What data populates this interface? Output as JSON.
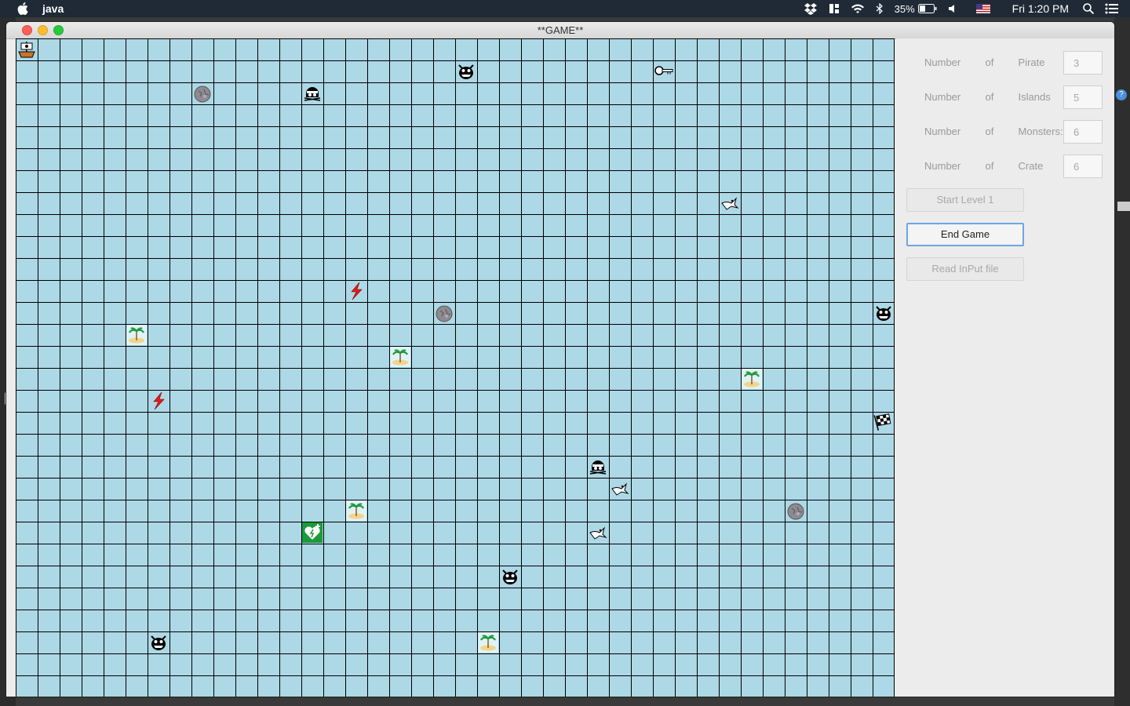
{
  "menubar": {
    "app_name": "java",
    "battery": "35%",
    "clock": "Fri 1:20 PM"
  },
  "window": {
    "title": "**GAME**"
  },
  "panel": {
    "fields": [
      {
        "label": "Number  of  Pirate   :",
        "value": "3"
      },
      {
        "label": "Number  of  Islands  :",
        "value": "5"
      },
      {
        "label": "Number  of  Monsters:",
        "value": "6"
      },
      {
        "label": "Number  of  Crate    :",
        "value": "6"
      }
    ],
    "buttons": {
      "start": "Start Level 1",
      "end": "End Game",
      "read": "Read InPut file"
    }
  },
  "board": {
    "cols": 40,
    "rows": 30,
    "pieces": [
      {
        "type": "pirate-ship",
        "col": 0,
        "row": 0
      },
      {
        "type": "rock",
        "col": 8,
        "row": 2
      },
      {
        "type": "skull",
        "col": 13,
        "row": 2
      },
      {
        "type": "monster",
        "col": 20,
        "row": 1
      },
      {
        "type": "key",
        "col": 29,
        "row": 1
      },
      {
        "type": "bird",
        "col": 32,
        "row": 7
      },
      {
        "type": "lightning",
        "col": 15,
        "row": 11
      },
      {
        "type": "rock",
        "col": 19,
        "row": 12
      },
      {
        "type": "monster",
        "col": 39,
        "row": 12
      },
      {
        "type": "island",
        "col": 5,
        "row": 13
      },
      {
        "type": "island",
        "col": 17,
        "row": 14
      },
      {
        "type": "island",
        "col": 33,
        "row": 15
      },
      {
        "type": "lightning",
        "col": 6,
        "row": 16
      },
      {
        "type": "flag",
        "col": 39,
        "row": 17
      },
      {
        "type": "skull",
        "col": 26,
        "row": 19
      },
      {
        "type": "bird",
        "col": 27,
        "row": 20
      },
      {
        "type": "island",
        "col": 15,
        "row": 21
      },
      {
        "type": "rock",
        "col": 35,
        "row": 21
      },
      {
        "type": "health",
        "col": 13,
        "row": 22
      },
      {
        "type": "bird",
        "col": 26,
        "row": 22
      },
      {
        "type": "monster",
        "col": 22,
        "row": 24
      },
      {
        "type": "monster",
        "col": 6,
        "row": 27
      },
      {
        "type": "island",
        "col": 21,
        "row": 27
      }
    ]
  }
}
